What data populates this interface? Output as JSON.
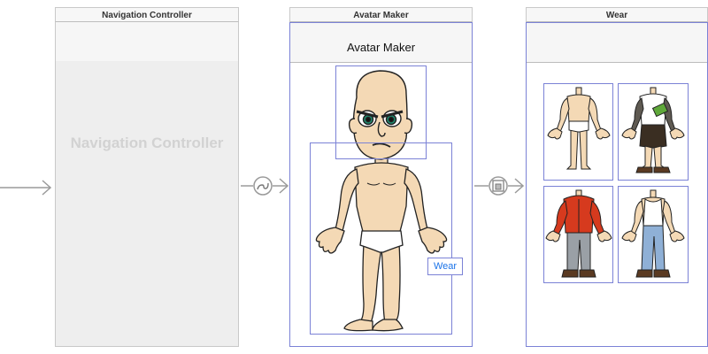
{
  "scenes": {
    "navigation_controller": {
      "title": "Navigation Controller",
      "placeholder_label": "Navigation Controller"
    },
    "avatar_maker": {
      "title": "Avatar Maker",
      "nav_title": "Avatar Maker",
      "wear_button_label": "Wear"
    },
    "wear": {
      "title": "Wear",
      "outfit_count": 4
    }
  },
  "icons": {
    "initial_arrow": "arrow-right-icon",
    "push_segue": "push-segue-icon",
    "embed_segue": "embed-segue-icon",
    "battery": "battery-icon"
  },
  "colors": {
    "selection": "#7b82d6",
    "link_blue": "#1a73e8",
    "placeholder_text": "#d2d2d2",
    "skin": "#f4d9b5"
  }
}
